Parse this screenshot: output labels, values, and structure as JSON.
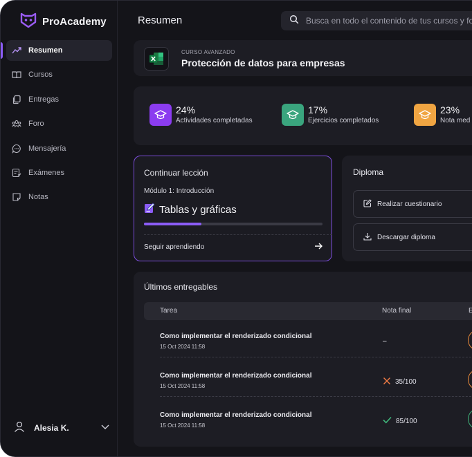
{
  "app": {
    "name": "ProAcademy"
  },
  "sidebar": {
    "items": [
      {
        "label": "Resumen",
        "icon": "trend-up-icon",
        "active": true
      },
      {
        "label": "Cursos",
        "icon": "book-icon"
      },
      {
        "label": "Entregas",
        "icon": "copy-icon"
      },
      {
        "label": "Foro",
        "icon": "users-icon"
      },
      {
        "label": "Mensajería",
        "icon": "chat-icon"
      },
      {
        "label": "Exámenes",
        "icon": "exam-icon"
      },
      {
        "label": "Notas",
        "icon": "note-icon"
      }
    ],
    "user": {
      "name": "Alesia K."
    }
  },
  "header": {
    "title": "Resumen",
    "search_placeholder": "Busca en todo el contenido de tus cursos y fo"
  },
  "course": {
    "level": "CURSO AVANZADO",
    "title": "Protección de datos para empresas",
    "icon": "excel-icon"
  },
  "stats": [
    {
      "value": "24%",
      "label": "Actividades completadas",
      "color": "#8b3cf0"
    },
    {
      "value": "17%",
      "label": "Ejercicios completados",
      "color": "#3aa57e"
    },
    {
      "value": "23%",
      "label": "Nota med",
      "color": "#f0a542"
    }
  ],
  "lesson": {
    "heading": "Continuar lección",
    "module": "Módulo 1: Introducción",
    "title": "Tablas y gráficas",
    "progress": 0.32,
    "cta": "Seguir aprendiendo"
  },
  "diploma": {
    "heading": "Diploma",
    "buttons": [
      {
        "label": "Realizar cuestionario",
        "icon": "edit-icon"
      },
      {
        "label": "Descargar diploma",
        "icon": "download-icon"
      }
    ]
  },
  "deliverables": {
    "heading": "Últimos entregables",
    "columns": [
      "Tarea",
      "Nota final",
      "E"
    ],
    "rows": [
      {
        "title": "Como implementar el renderizado condicional",
        "date": "15 Oct 2024 11:58",
        "grade": "–",
        "status": "pending",
        "status_color": "#e88a3c"
      },
      {
        "title": "Como implementar el renderizado condicional",
        "date": "15 Oct 2024 11:58",
        "grade": "35/100",
        "status": "failed",
        "status_color": "#e88a3c"
      },
      {
        "title": "Como implementar el renderizado condicional",
        "date": "15 Oct 2024 11:58",
        "grade": "85/100",
        "status": "passed",
        "status_color": "#3fb47a"
      }
    ]
  }
}
